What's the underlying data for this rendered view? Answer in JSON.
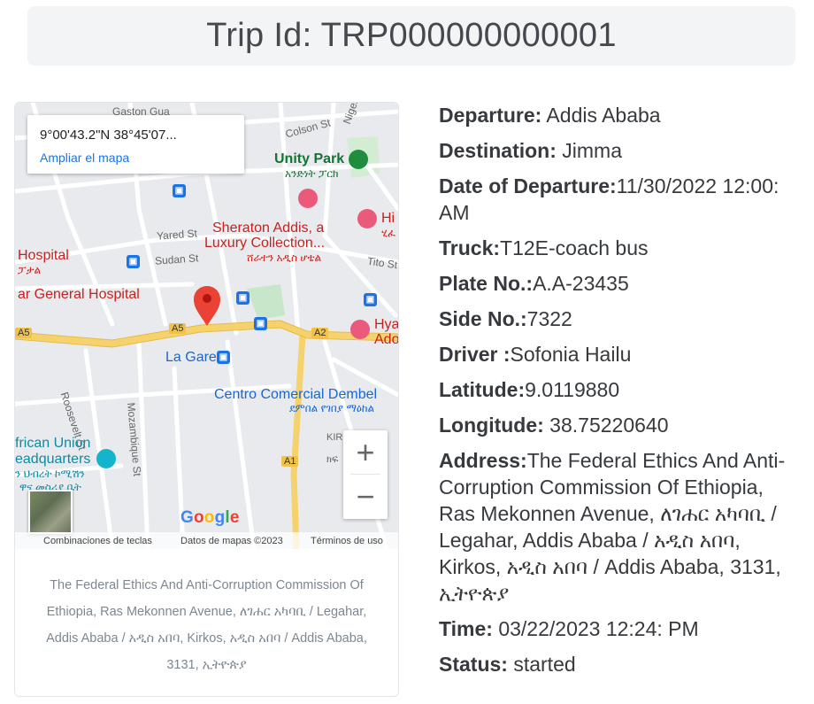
{
  "header": {
    "title": "Trip Id: TRP000000000001"
  },
  "map": {
    "info_coords": "9°00'43.2\"N 38°45'07...",
    "info_link": "Ampliar el mapa",
    "labels": {
      "gaston": "Gaston Gua",
      "colson": "Colson St",
      "niger": "Niger",
      "unity_park": "Unity Park",
      "unity_park_am": "አንድነት ፓርክ",
      "sheraton_1": "Sheraton Addis, a",
      "sheraton_2": "Luxury Collection...",
      "sheraton_am": "ሸራተን አዲስ ሆቴል",
      "hi": "Hi",
      "hi_am": "ሂፈ",
      "yared": "Yared St",
      "sudan": "Sudan St",
      "tito": "Tito St",
      "hospital": "Hospital",
      "hospital_am": "ፓታል",
      "general_hospital": "ar General Hospital",
      "hya": "Hya",
      "ado": "Ado",
      "a5_left": "A5",
      "a5_mid": "A5",
      "a2": "A2",
      "a1": "A1",
      "la_gare": "La Gare",
      "centro": "Centro Comercial Dembel",
      "centro_am": "ደምበል የገበያ ማዕከል",
      "roosevelt": "Roosevelt St",
      "mozambique": "Mozambique St",
      "kir": "KIR",
      "kir_am": "ክፍ",
      "african_union_1": "frican Union",
      "african_union_2": "eadquarters",
      "au_am_1": "ን ህብረት ኮሚሽን",
      "au_am_2": "ዋና መስሪያ ቤት"
    },
    "google": "Google",
    "attribution": {
      "shortcuts": "Combinaciones de teclas",
      "data": "Datos de mapas ©2023",
      "terms": "Términos de uso"
    },
    "zoom_in": "+",
    "zoom_out": "−"
  },
  "card": {
    "address": "The Federal Ethics And Anti-Corruption Commission Of Ethiopia, Ras Mekonnen Avenue, ለገሐር አካባቢ / Legahar, Addis Ababa / አዲስ አበባ, Kirkos, አዲስ አበባ / Addis Ababa, 3131, ኢትዮጵያ"
  },
  "details": {
    "departure_label": "Departure:",
    "departure_value": " Addis Ababa",
    "destination_label": "Destination:",
    "destination_value": " Jimma",
    "date_label": "Date of Departure:",
    "date_value": "11/30/2022 12:00: AM",
    "truck_label": "Truck:",
    "truck_value": "T12E-coach bus",
    "plate_label": "Plate No.:",
    "plate_value": "A.A-23435",
    "side_label": "Side No.:",
    "side_value": "7322",
    "driver_label": "Driver :",
    "driver_value": "Sofonia Hailu",
    "latitude_label": "Latitude:",
    "latitude_value": "9.0119880",
    "longitude_label": "Longitude:",
    "longitude_value": " 38.75220640",
    "address_label": "Address:",
    "address_value": "The Federal Ethics And Anti-Corruption Commission Of Ethiopia, Ras Mekonnen Avenue, ለገሐር አካባቢ / Legahar, Addis Ababa / አዲስ አበባ, Kirkos, አዲስ አበባ / Addis Ababa, 3131, ኢትዮጵያ",
    "time_label": "Time:",
    "time_value": " 03/22/2023 12:24: PM",
    "status_label": "Status:",
    "status_value": " started"
  },
  "colors": {
    "highway": "#f5d26b",
    "road": "#ffffff",
    "map_bg": "#e8eaed",
    "marker": "#ea4335",
    "park": "#c8e6c9"
  }
}
